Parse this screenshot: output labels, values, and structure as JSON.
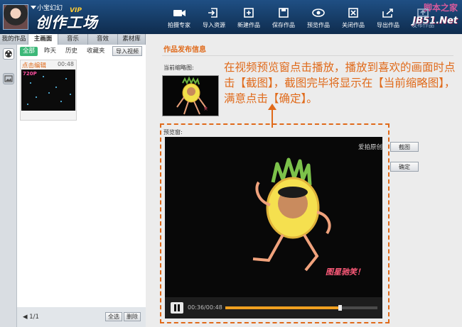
{
  "header": {
    "username": "小宝幻幻",
    "vip": "VIP",
    "logo_text": "创作工场",
    "toolbar": [
      {
        "label": "拍摄专家",
        "icon": "camera-icon"
      },
      {
        "label": "导入资源",
        "icon": "import-icon"
      },
      {
        "label": "新建作品",
        "icon": "new-icon"
      },
      {
        "label": "保存作品",
        "icon": "save-icon"
      },
      {
        "label": "预览作品",
        "icon": "eye-icon"
      },
      {
        "label": "关闭作品",
        "icon": "close-doc-icon"
      },
      {
        "label": "导出作品",
        "icon": "export-icon"
      },
      {
        "label": "发布作品",
        "icon": "publish-icon"
      }
    ]
  },
  "watermark": {
    "top": "脚本之家",
    "bottom": "JB51.Net"
  },
  "left_panel": {
    "tabs": [
      "我的作品",
      "主画面",
      "音乐",
      "音效",
      "素材库"
    ],
    "active_tab": "主画面",
    "filters": [
      "全部",
      "昨天",
      "历史",
      "收藏夹"
    ],
    "import_button": "导入视频",
    "card": {
      "title": "点击编辑",
      "duration": "00:48",
      "badge": "720P"
    },
    "pagination": "1/1",
    "select_all": "全选",
    "delete": "删除"
  },
  "right_panel": {
    "section_title": "作品发布信息",
    "thumbnail_label": "当前缩略图:",
    "preview_label": "预览窗:",
    "callout": "在视频预览窗点击播放，播放到喜欢的画面时点击【截图】，截图完毕将显示在【当前缩略图】，满意点击【确定】。",
    "video_watermark": "爱拍原创",
    "video_caption": "图星驰笑！",
    "time": "00:36/00:48",
    "progress": 0.75,
    "screenshot_button": "截图",
    "confirm_button": "确定"
  },
  "colors": {
    "accent": "#e06a1a",
    "header": "#163c66",
    "progress": "#f0a020",
    "filter_active": "#3cb878"
  }
}
